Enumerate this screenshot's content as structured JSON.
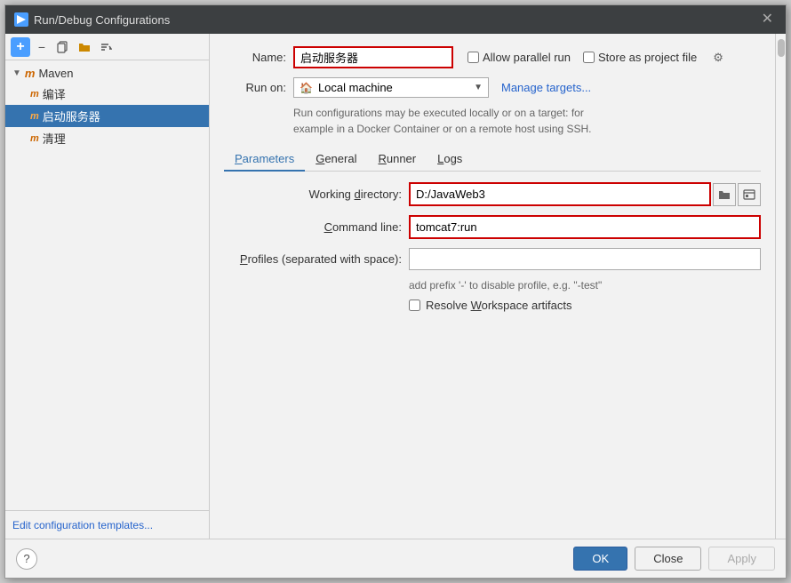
{
  "dialog": {
    "title": "Run/Debug Configurations",
    "title_icon": "▶",
    "close_label": "✕"
  },
  "toolbar": {
    "add_label": "+",
    "remove_label": "−",
    "copy_label": "⧉",
    "folder_label": "📁",
    "sort_label": "↕"
  },
  "tree": {
    "group_label": "Maven",
    "items": [
      {
        "label": "编译",
        "selected": false
      },
      {
        "label": "启动服务器",
        "selected": true
      },
      {
        "label": "清理",
        "selected": false
      }
    ]
  },
  "left_footer": {
    "link_label": "Edit configuration templates..."
  },
  "form": {
    "name_label": "Name:",
    "name_value": "启动服务器",
    "allow_parallel_label": "Allow parallel run",
    "store_project_label": "Store as project file",
    "run_on_label": "Run on:",
    "run_on_value": "Local machine",
    "run_on_icon": "🏠",
    "manage_targets_label": "Manage targets...",
    "info_text": "Run configurations may be executed locally or on a target: for\nexample in a Docker Container or on a remote host using SSH."
  },
  "tabs": [
    {
      "label": "Parameters",
      "underline": "P",
      "active": true
    },
    {
      "label": "General",
      "underline": "G",
      "active": false
    },
    {
      "label": "Runner",
      "underline": "R",
      "active": false
    },
    {
      "label": "Logs",
      "underline": "L",
      "active": false
    }
  ],
  "fields": {
    "working_directory_label": "Working directory:",
    "working_directory_underline": "d",
    "working_directory_value": "D:/JavaWeb3",
    "command_line_label": "Command line:",
    "command_line_underline": "C",
    "command_line_value": "tomcat7:run",
    "profiles_label": "Profiles (separated with space):",
    "profiles_underline": "P",
    "profiles_value": "",
    "hint_text": "add prefix '-' to disable profile, e.g. \"-test\"",
    "resolve_workspace_label": "Resolve Workspace artifacts",
    "resolve_workspace_underline": "W"
  },
  "footer": {
    "help_label": "?",
    "ok_label": "OK",
    "close_label": "Close",
    "apply_label": "Apply"
  },
  "scrollbar": {
    "visible": true
  }
}
